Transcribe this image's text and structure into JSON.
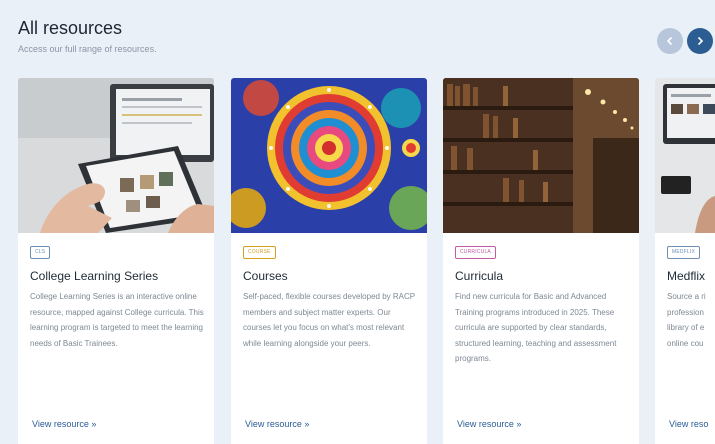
{
  "section": {
    "title": "All resources",
    "subtitle": "Access our full range of resources."
  },
  "nav": {
    "prev_icon": "chevron-left-icon",
    "next_icon": "chevron-right-icon"
  },
  "cards": [
    {
      "badge": "CLS",
      "badge_color": "#6f8fb5",
      "title": "College Learning Series",
      "description": "College Learning Series is an interactive online resource, mapped against College curricula. This learning program is targeted to meet the learning needs of Basic Trainees.",
      "link": "View resource »"
    },
    {
      "badge": "COURSE",
      "badge_color": "#d4a11e",
      "title": "Courses",
      "description": "Self-paced, flexible courses developed by RACP members and subject matter experts. Our courses let you focus on what's most relevant while learning alongside your peers.",
      "link": "View resource »"
    },
    {
      "badge": "CURRICULA",
      "badge_color": "#c25aa6",
      "title": "Curricula",
      "description": "Find new curricula for Basic and Advanced Training programs introduced in 2025. These curricula are supported by clear standards, structured learning, teaching and assessment programs.",
      "link": "View resource »"
    },
    {
      "badge": "MEDFLIX",
      "badge_color": "#6f8fb5",
      "title": "Medflix",
      "description": "Source a ri profession library of e online cou",
      "link": "View reso"
    }
  ]
}
